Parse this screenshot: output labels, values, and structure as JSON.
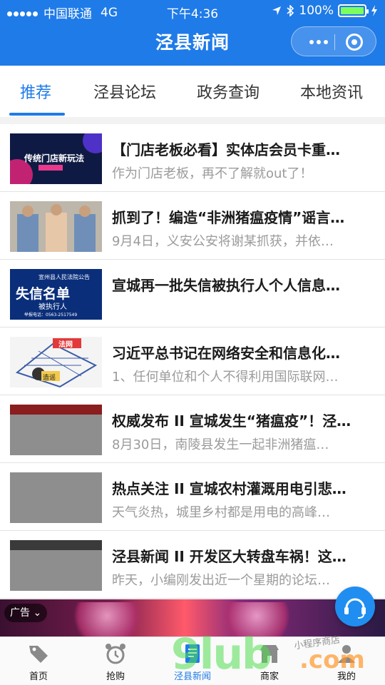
{
  "status_bar": {
    "carrier": "中国联通",
    "network": "4G",
    "time": "下午4:36",
    "battery": "100%"
  },
  "header": {
    "title": "泾县新闻"
  },
  "tabs": [
    {
      "label": "推荐"
    },
    {
      "label": "泾县论坛"
    },
    {
      "label": "政务查询"
    },
    {
      "label": "本地资讯"
    }
  ],
  "thumb_text": {
    "item0": "传统门店新玩法",
    "item2_top": "宣州县人民法院公告",
    "item2_main": "失信名单",
    "item2_sub": "被执行人",
    "item2_phone": "举报电话：0563-2517549",
    "item3_sign": "法网",
    "item3_tag": "造谣"
  },
  "news": [
    {
      "title": "【门店老板必看】实体店会员卡重…",
      "summary": "作为门店老板，再不了解就out了！"
    },
    {
      "title": "抓到了！编造“非洲猪瘟疫情”谣言…",
      "summary": "9月4日，义安公安将谢某抓获，并依…"
    },
    {
      "title": "宣城再一批失信被执行人个人信息…",
      "summary": ""
    },
    {
      "title": "习近平总书记在网络安全和信息化…",
      "summary": "1、任何单位和个人不得利用国际联网…"
    },
    {
      "title": "权威发布 II 宣城发生“猪瘟疫”！泾…",
      "summary": "8月30日，南陵县发生一起非洲猪瘟…"
    },
    {
      "title": "热点关注 II 宣城农村灌溉用电引悲…",
      "summary": "天气炎热，城里乡村都是用电的高峰…"
    },
    {
      "title": "泾县新闻 II 开发区大转盘车祸！这…",
      "summary": "昨天，小编刚发出近一个星期的论坛…"
    }
  ],
  "ad": {
    "tag": "广告"
  },
  "tabbar": [
    {
      "label": "首页"
    },
    {
      "label": "抢购"
    },
    {
      "label": "泾县新闻"
    },
    {
      "label": "商家"
    },
    {
      "label": "我的"
    }
  ],
  "watermark": {
    "main": "9lub",
    "suffix": ".com",
    "small": "小程序商店"
  },
  "colors": {
    "accent": "#1f7be8",
    "text_primary": "#1b1b1b",
    "text_secondary": "#9b9b9b"
  }
}
